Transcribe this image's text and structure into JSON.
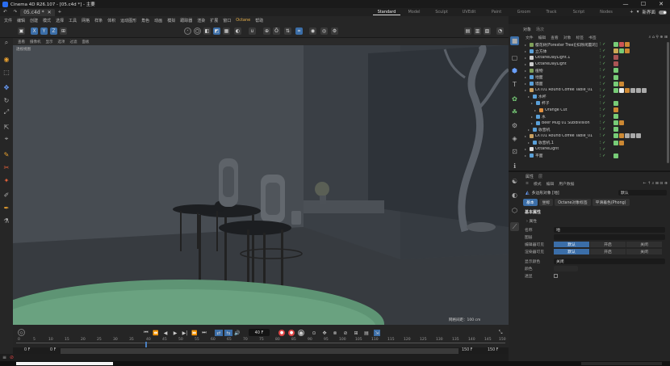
{
  "window": {
    "title": "Cinema 4D R26.107 - [05.c4d *] - 主要",
    "controls": [
      "—",
      "☐",
      "✕"
    ]
  },
  "tabs": {
    "doc": "05.c4d *",
    "plus": "+"
  },
  "layouts": [
    "Standard",
    "Model",
    "Sculpt",
    "UVEdit",
    "Paint",
    "Groom",
    "Track",
    "Script",
    "Nodes"
  ],
  "layouts_right": {
    "new": "新界面"
  },
  "menu": [
    "文件",
    "编辑",
    "创建",
    "模式",
    "选择",
    "工具",
    "网格",
    "样条",
    "体积",
    "运动图形",
    "角色",
    "动画",
    "模拟",
    "跟踪器",
    "渲染",
    "扩展",
    "窗口",
    "Octane",
    "帮助"
  ],
  "menu_highlight": "Octane",
  "toolbar": {
    "x": "X",
    "y": "Y",
    "z": "Z"
  },
  "viewport": {
    "menu": [
      "查看",
      "摄像机",
      "显示",
      "选项",
      "过滤",
      "面板"
    ],
    "label": "透视视图",
    "grid": "网格间距：100 cm"
  },
  "timeline": {
    "frames": [
      "0",
      "5",
      "10",
      "15",
      "20",
      "25",
      "30",
      "35",
      "40",
      "45",
      "50",
      "55",
      "60",
      "65",
      "70",
      "75",
      "80",
      "85",
      "90",
      "95",
      "100",
      "105",
      "110",
      "115",
      "120",
      "125",
      "130",
      "135",
      "140",
      "145",
      "150"
    ],
    "current": "40 F",
    "start": "0 F",
    "start2": "0 F",
    "end": "150 F",
    "end2": "150 F"
  },
  "right": {
    "tabs": [
      "对象",
      "场次"
    ],
    "menu": [
      "文件",
      "编辑",
      "查看",
      "对象",
      "标签",
      "书签"
    ],
    "objects": [
      {
        "name": "樱花树(Forester Tree)[扣除闲置的]",
        "color": "#7fa05a"
      },
      {
        "name": "立方体",
        "color": "#5aa0d8"
      },
      {
        "name": "OctaneDayLight.1",
        "color": "#cccccc"
      },
      {
        "name": "OctaneDayLight",
        "color": "#cccccc"
      },
      {
        "name": "植物",
        "color": "#7fa05a"
      },
      {
        "name": "地面",
        "color": "#5aa0d8"
      },
      {
        "name": "墙面",
        "color": "#5aa0d8"
      },
      {
        "name": "LXT01 Round Coffee Table_01",
        "color": "#c8a060"
      },
      {
        "name": "水杯",
        "color": "#5aa0d8"
      },
      {
        "name": "杯子",
        "color": "#5aa0d8"
      },
      {
        "name": "Orange Cut",
        "color": "#e09040"
      },
      {
        "name": "水",
        "color": "#5aa0d8"
      },
      {
        "name": "Beer Mug 01 Subdivision",
        "color": "#5aa0d8"
      },
      {
        "name": "收音机",
        "color": "#5aa0d8"
      },
      {
        "name": "LXT01 Round Coffee Table_01",
        "color": "#c8a060"
      },
      {
        "name": "收音机.1",
        "color": "#5aa0d8"
      },
      {
        "name": "OctaneLight",
        "color": "#dddddd"
      },
      {
        "name": "平面",
        "color": "#5aa0d8"
      }
    ],
    "attr": {
      "tabs": [
        "属性",
        "层"
      ],
      "menu": [
        "模式",
        "编辑",
        "用户数据"
      ],
      "object": "多边形对象 [地]",
      "dropdown": "默认",
      "subtabs": [
        "基本",
        "坐标",
        "Octane对象标签",
        "平滑着色(Phong)"
      ],
      "section": "基本属性",
      "sub": "属性",
      "rows": [
        {
          "label": "名称",
          "value": "地"
        },
        {
          "label": "图层",
          "value": ""
        },
        {
          "label": "编辑器可见",
          "opts": [
            "默认",
            "开启",
            "关闭"
          ]
        },
        {
          "label": "渲染器可见",
          "opts": [
            "默认",
            "开启",
            "关闭"
          ]
        },
        {
          "label": "显示颜色",
          "value": "关闭"
        },
        {
          "label": "颜色",
          "value": ""
        },
        {
          "label": "透显",
          "value": ""
        }
      ]
    }
  }
}
